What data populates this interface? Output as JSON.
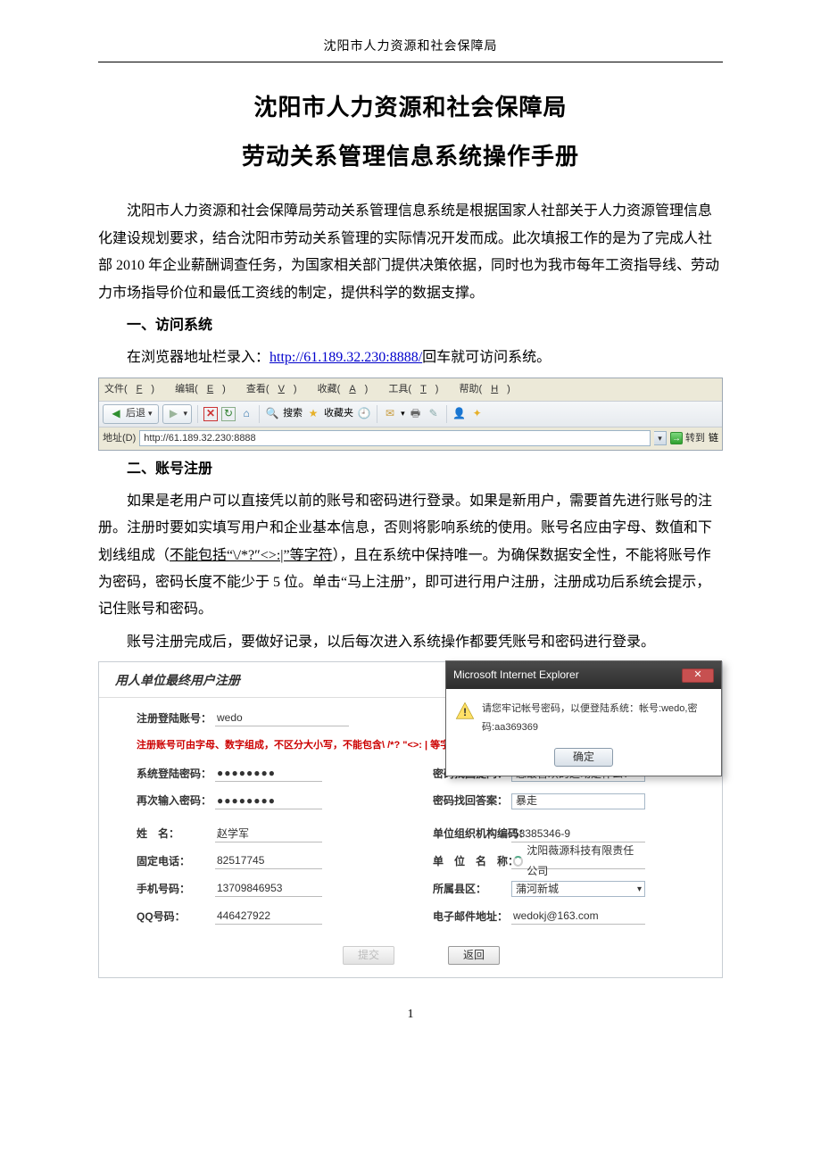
{
  "doc_header": "沈阳市人力资源和社会保障局",
  "title1": "沈阳市人力资源和社会保障局",
  "title2": "劳动关系管理信息系统操作手册",
  "intro": "沈阳市人力资源和社会保障局劳动关系管理信息系统是根据国家人社部关于人力资源管理信息化建设规划要求，结合沈阳市劳动关系管理的实际情况开发而成。此次填报工作的是为了完成人社部 2010 年企业薪酬调查任务，为国家相关部门提供决策依据，同时也为我市每年工资指导线、劳动力市场指导价位和最低工资线的制定，提供科学的数据支撑。",
  "section1_title": "一、访问系统",
  "section1_prefix": "在浏览器地址栏录入：",
  "section1_url": "http://61.189.32.230:8888/",
  "section1_suffix": "回车就可访问系统。",
  "browser": {
    "menu": {
      "file": "文件(",
      "file_a": "F",
      "file_c": ")",
      "edit": "编辑(",
      "edit_a": "E",
      "edit_c": ")",
      "view": "查看(",
      "view_a": "V",
      "view_c": ")",
      "fav": "收藏(",
      "fav_a": "A",
      "fav_c": ")",
      "tools": "工具(",
      "tools_a": "T",
      "tools_c": ")",
      "help": "帮助(",
      "help_a": "H",
      "help_c": ")"
    },
    "back": "后退",
    "search": "搜索",
    "fav_btn": "收藏夹",
    "addr_label": "地址(D)",
    "addr_value": "http://61.189.32.230:8888",
    "go": "转到",
    "links": "链"
  },
  "section2_title": "二、账号注册",
  "p2a_1": "如果是老用户可以直接凭以前的账号和密码进行登录。如果是新用户，需要首先进行账号的注册。注册时要如实填写用户和企业基本信息，否则将影响系统的使用。账号名应由字母、数值和下划线组成（",
  "p2a_ul": "不能包括“\\/*?″<>:|”等字符",
  "p2a_2": "），且在系统中保持唯一。为确保数据安全性，不能将账号作为密码，密码长度不能少于 5 位。单击“马上注册”，即可进行用户注册，注册成功后系统会提示，记住账号和密码。",
  "p2b": "账号注册完成后，要做好记录，以后每次进入系统操作都要凭账号和密码进行登录。",
  "reg": {
    "header": "用人单位最终用户注册",
    "labels": {
      "account": "注册登陆账号：",
      "warn": "注册账号可由字母、数字组成，不区分大小写，不能包含\\ /*? \"<>: | 等字符",
      "password": "系统登陆密码：",
      "password2": "再次输入密码：",
      "q": "密码找回提问：",
      "a": "密码找回答案：",
      "name": "姓　名：",
      "org": "单位组织机构编码：",
      "tel": "固定电话：",
      "unit": "单　位　名　称：",
      "mobile": "手机号码：",
      "district": "所属县区：",
      "qq": "QQ号码：",
      "email": "电子邮件地址："
    },
    "values": {
      "account": "wedo",
      "pw": "●●●●●●●●",
      "q_selected": "您最喜欢的运动是什么?",
      "a_val": "暴走",
      "name": "赵学军",
      "org": "58385346-9",
      "tel": "82517745",
      "unit": "沈阳薇源科技有限责任公司",
      "mobile": "13709846953",
      "district": "蒲河新城",
      "qq": "446427922",
      "email": "wedokj@163.com"
    },
    "buttons": {
      "submit": "提交",
      "back": "返回"
    }
  },
  "dialog": {
    "title": "Microsoft Internet Explorer",
    "msg": "请您牢记帐号密码，以便登陆系统：帐号:wedo,密码:aa369369",
    "ok": "确定"
  },
  "page_num": "1"
}
